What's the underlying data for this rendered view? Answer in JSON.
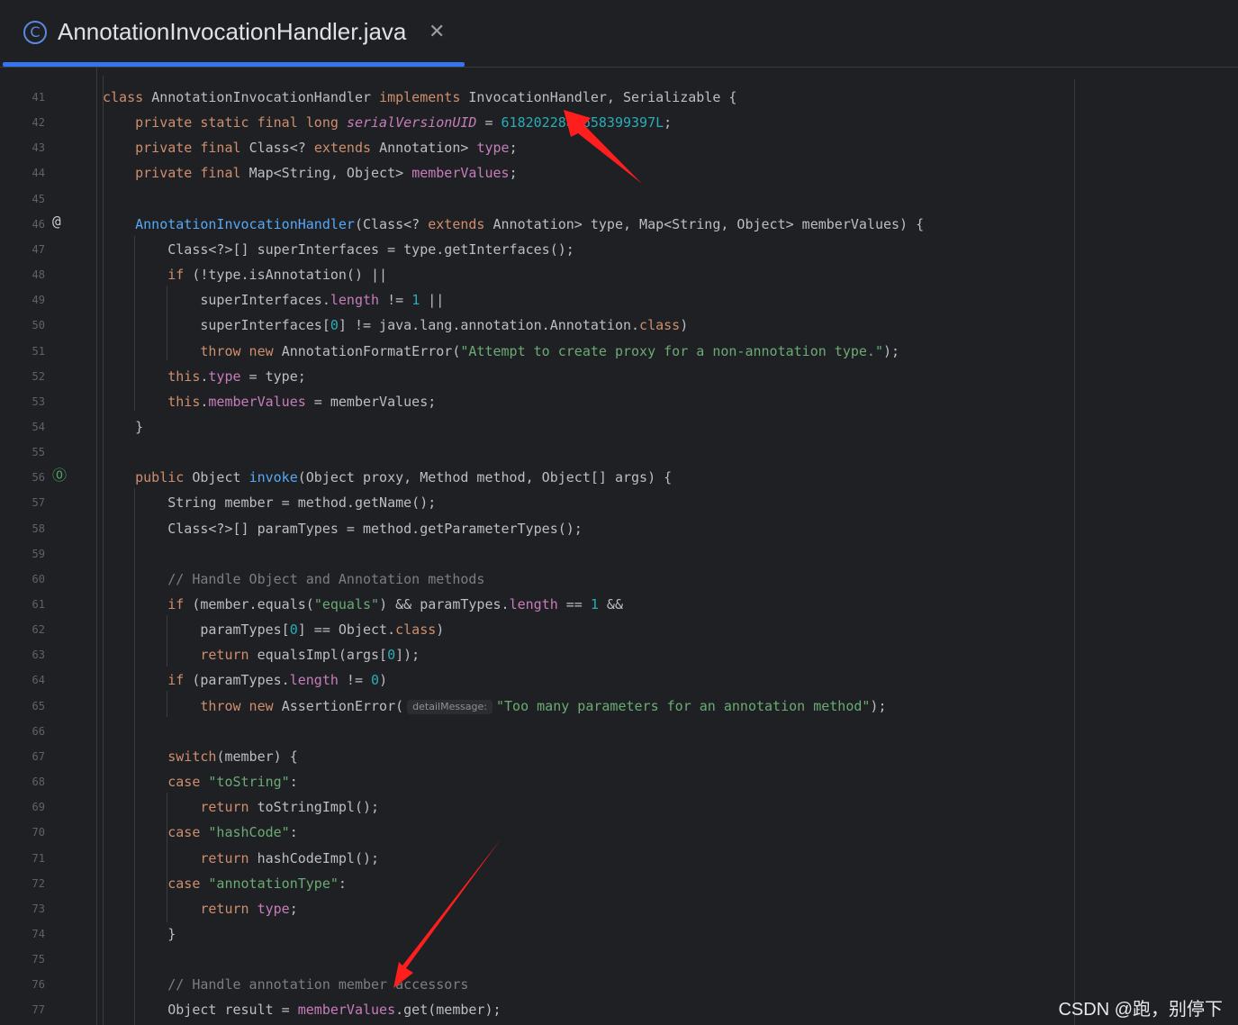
{
  "tab": {
    "title": "AnnotationInvocationHandler.java",
    "icon": "class-icon",
    "icon_glyph": "C",
    "close_glyph": "✕"
  },
  "gutter_icons": {
    "line46": "@",
    "line56": "⓪"
  },
  "lines": [
    {
      "n": "41",
      "tokens": [
        [
          "kw",
          "class "
        ],
        [
          "",
          "AnnotationInvocationHandler "
        ],
        [
          "kw",
          "implements "
        ],
        [
          "",
          "InvocationHandler, Serializable {"
        ]
      ]
    },
    {
      "n": "42",
      "tokens": [
        [
          "",
          "    "
        ],
        [
          "kw",
          "private static final long "
        ],
        [
          "stat",
          "serialVersionUID"
        ],
        [
          "",
          " = "
        ],
        [
          "num",
          "6182022883658399397L"
        ],
        [
          "",
          ";"
        ]
      ]
    },
    {
      "n": "43",
      "tokens": [
        [
          "",
          "    "
        ],
        [
          "kw",
          "private final "
        ],
        [
          "",
          "Class<? "
        ],
        [
          "kw",
          "extends "
        ],
        [
          "",
          "Annotation> "
        ],
        [
          "fld",
          "type"
        ],
        [
          "",
          ";"
        ]
      ]
    },
    {
      "n": "44",
      "tokens": [
        [
          "",
          "    "
        ],
        [
          "kw",
          "private final "
        ],
        [
          "",
          "Map<String, Object> "
        ],
        [
          "fld",
          "memberValues"
        ],
        [
          "",
          ";"
        ]
      ]
    },
    {
      "n": "45",
      "tokens": []
    },
    {
      "n": "46",
      "tokens": [
        [
          "",
          "    "
        ],
        [
          "fn",
          "AnnotationInvocationHandler"
        ],
        [
          "",
          "(Class<? "
        ],
        [
          "kw",
          "extends "
        ],
        [
          "",
          "Annotation> type, Map<String, Object> memberValues) {"
        ]
      ]
    },
    {
      "n": "47",
      "tokens": [
        [
          "",
          "        Class<?>[] superInterfaces = type.getInterfaces();"
        ]
      ]
    },
    {
      "n": "48",
      "tokens": [
        [
          "",
          "        "
        ],
        [
          "kw",
          "if "
        ],
        [
          "",
          "(!type.isAnnotation() ||"
        ]
      ]
    },
    {
      "n": "49",
      "tokens": [
        [
          "",
          "            superInterfaces."
        ],
        [
          "fld",
          "length"
        ],
        [
          "",
          " != "
        ],
        [
          "num",
          "1"
        ],
        [
          "",
          " ||"
        ]
      ]
    },
    {
      "n": "50",
      "tokens": [
        [
          "",
          "            superInterfaces["
        ],
        [
          "num",
          "0"
        ],
        [
          "",
          "] != java.lang.annotation.Annotation."
        ],
        [
          "kw",
          "class"
        ],
        [
          "",
          ")"
        ]
      ]
    },
    {
      "n": "51",
      "tokens": [
        [
          "",
          "            "
        ],
        [
          "kw",
          "throw new "
        ],
        [
          "",
          "AnnotationFormatError("
        ],
        [
          "str",
          "\"Attempt to create proxy for a non-annotation type.\""
        ],
        [
          "",
          ");"
        ]
      ]
    },
    {
      "n": "52",
      "tokens": [
        [
          "",
          "        "
        ],
        [
          "kw",
          "this"
        ],
        [
          "",
          "."
        ],
        [
          "fld",
          "type"
        ],
        [
          "",
          " = type;"
        ]
      ]
    },
    {
      "n": "53",
      "tokens": [
        [
          "",
          "        "
        ],
        [
          "kw",
          "this"
        ],
        [
          "",
          "."
        ],
        [
          "fld",
          "memberValues"
        ],
        [
          "",
          " = memberValues;"
        ]
      ]
    },
    {
      "n": "54",
      "tokens": [
        [
          "",
          "    }"
        ]
      ]
    },
    {
      "n": "55",
      "tokens": []
    },
    {
      "n": "56",
      "tokens": [
        [
          "",
          "    "
        ],
        [
          "kw",
          "public "
        ],
        [
          "",
          "Object "
        ],
        [
          "fn",
          "invoke"
        ],
        [
          "",
          "(Object proxy, Method method, Object[] args) {"
        ]
      ]
    },
    {
      "n": "57",
      "tokens": [
        [
          "",
          "        String member = method.getName();"
        ]
      ]
    },
    {
      "n": "58",
      "tokens": [
        [
          "",
          "        Class<?>[] paramTypes = method.getParameterTypes();"
        ]
      ]
    },
    {
      "n": "59",
      "tokens": []
    },
    {
      "n": "60",
      "tokens": [
        [
          "",
          "        "
        ],
        [
          "cmt",
          "// Handle Object and Annotation methods"
        ]
      ]
    },
    {
      "n": "61",
      "tokens": [
        [
          "",
          "        "
        ],
        [
          "kw",
          "if "
        ],
        [
          "",
          "(member.equals("
        ],
        [
          "str",
          "\"equals\""
        ],
        [
          "",
          ") && paramTypes."
        ],
        [
          "fld",
          "length"
        ],
        [
          "",
          " == "
        ],
        [
          "num",
          "1"
        ],
        [
          "",
          " &&"
        ]
      ]
    },
    {
      "n": "62",
      "tokens": [
        [
          "",
          "            paramTypes["
        ],
        [
          "num",
          "0"
        ],
        [
          "",
          "] == Object."
        ],
        [
          "kw",
          "class"
        ],
        [
          "",
          ")"
        ]
      ]
    },
    {
      "n": "63",
      "tokens": [
        [
          "",
          "            "
        ],
        [
          "kw",
          "return "
        ],
        [
          "",
          "equalsImpl(args["
        ],
        [
          "num",
          "0"
        ],
        [
          "",
          "]);"
        ]
      ]
    },
    {
      "n": "64",
      "tokens": [
        [
          "",
          "        "
        ],
        [
          "kw",
          "if "
        ],
        [
          "",
          "(paramTypes."
        ],
        [
          "fld",
          "length"
        ],
        [
          "",
          " != "
        ],
        [
          "num",
          "0"
        ],
        [
          "",
          ")"
        ]
      ]
    },
    {
      "n": "65",
      "tokens": [
        [
          "",
          "            "
        ],
        [
          "kw",
          "throw new "
        ],
        [
          "",
          "AssertionError("
        ],
        [
          "hint",
          "detailMessage:"
        ],
        [
          "str",
          "\"Too many parameters for an annotation method\""
        ],
        [
          "",
          ");"
        ]
      ]
    },
    {
      "n": "66",
      "tokens": []
    },
    {
      "n": "67",
      "tokens": [
        [
          "",
          "        "
        ],
        [
          "kw",
          "switch"
        ],
        [
          "",
          "(member) {"
        ]
      ]
    },
    {
      "n": "68",
      "tokens": [
        [
          "",
          "        "
        ],
        [
          "kw",
          "case "
        ],
        [
          "str",
          "\"toString\""
        ],
        [
          "",
          ":"
        ]
      ]
    },
    {
      "n": "69",
      "tokens": [
        [
          "",
          "            "
        ],
        [
          "kw",
          "return "
        ],
        [
          "",
          "toStringImpl();"
        ]
      ]
    },
    {
      "n": "70",
      "tokens": [
        [
          "",
          "        "
        ],
        [
          "kw",
          "case "
        ],
        [
          "str",
          "\"hashCode\""
        ],
        [
          "",
          ":"
        ]
      ]
    },
    {
      "n": "71",
      "tokens": [
        [
          "",
          "            "
        ],
        [
          "kw",
          "return "
        ],
        [
          "",
          "hashCodeImpl();"
        ]
      ]
    },
    {
      "n": "72",
      "tokens": [
        [
          "",
          "        "
        ],
        [
          "kw",
          "case "
        ],
        [
          "str",
          "\"annotationType\""
        ],
        [
          "",
          ":"
        ]
      ]
    },
    {
      "n": "73",
      "tokens": [
        [
          "",
          "            "
        ],
        [
          "kw",
          "return "
        ],
        [
          "fld",
          "type"
        ],
        [
          "",
          ";"
        ]
      ]
    },
    {
      "n": "74",
      "tokens": [
        [
          "",
          "        }"
        ]
      ]
    },
    {
      "n": "75",
      "tokens": []
    },
    {
      "n": "76",
      "tokens": [
        [
          "",
          "        "
        ],
        [
          "cmt",
          "// Handle annotation member accessors"
        ]
      ]
    },
    {
      "n": "77",
      "tokens": [
        [
          "",
          "        Object result = "
        ],
        [
          "fld",
          "memberValues"
        ],
        [
          "",
          ".get(member);"
        ]
      ]
    }
  ],
  "watermark": "CSDN @跑，别停下",
  "colors": {
    "background": "#1f2023",
    "keyword": "#cf8e6d",
    "function": "#56a8f5",
    "field": "#c77dbb",
    "number": "#2aacb8",
    "string": "#6aab73",
    "comment": "#7a7e85",
    "accent": "#3574f0",
    "arrow": "#ff1e1e"
  }
}
